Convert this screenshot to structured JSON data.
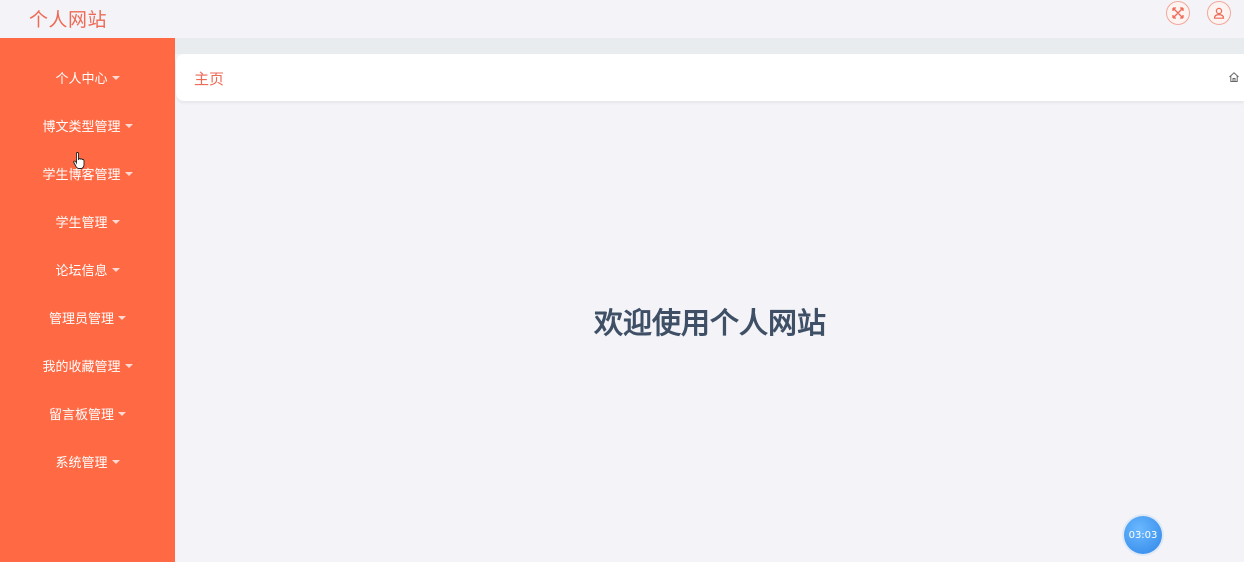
{
  "header": {
    "site_title": "个人网站",
    "fullscreen_icon": "fullscreen-icon",
    "user_icon": "user-icon"
  },
  "sidebar": {
    "items": [
      {
        "label": "个人中心"
      },
      {
        "label": "博文类型管理"
      },
      {
        "label": "学生博客管理"
      },
      {
        "label": "学生管理"
      },
      {
        "label": "论坛信息"
      },
      {
        "label": "管理员管理"
      },
      {
        "label": "我的收藏管理"
      },
      {
        "label": "留言板管理"
      },
      {
        "label": "系统管理"
      }
    ]
  },
  "breadcrumb": {
    "home_label": "主页",
    "home_icon": "home-icon"
  },
  "main": {
    "welcome_text": "欢迎使用个人网站"
  },
  "timer": {
    "text": "03:03"
  },
  "colors": {
    "accent": "#ee6a56",
    "sidebar_bg": "#ff6a45",
    "welcome_text": "#3e4f66",
    "timer_bg": "#2f86e8"
  }
}
